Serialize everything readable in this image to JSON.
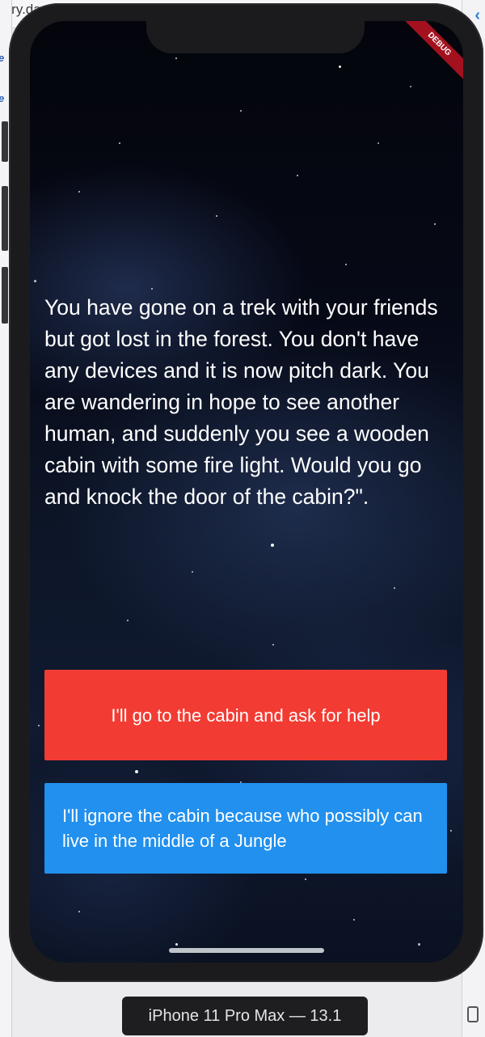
{
  "ide": {
    "tab_text": "tory.da"
  },
  "app": {
    "debug_banner": "DEBUG",
    "story_text": "You have gone on a trek with your friends but got lost in the forest. You don't have any devices and it is now pitch dark. You are wandering in hope to see another human, and suddenly you see a wooden cabin with some fire light. Would you go and knock the door of the cabin?\".",
    "choice1_label": "I'll go to the cabin and ask for help",
    "choice2_label": "I'll ignore the cabin because who possibly can live in the middle of a Jungle",
    "choice1_color": "#f23c33",
    "choice2_color": "#2190ee",
    "background": "night-sky-stars"
  },
  "simulator": {
    "device_label": "iPhone 11 Pro Max — 13.1"
  }
}
